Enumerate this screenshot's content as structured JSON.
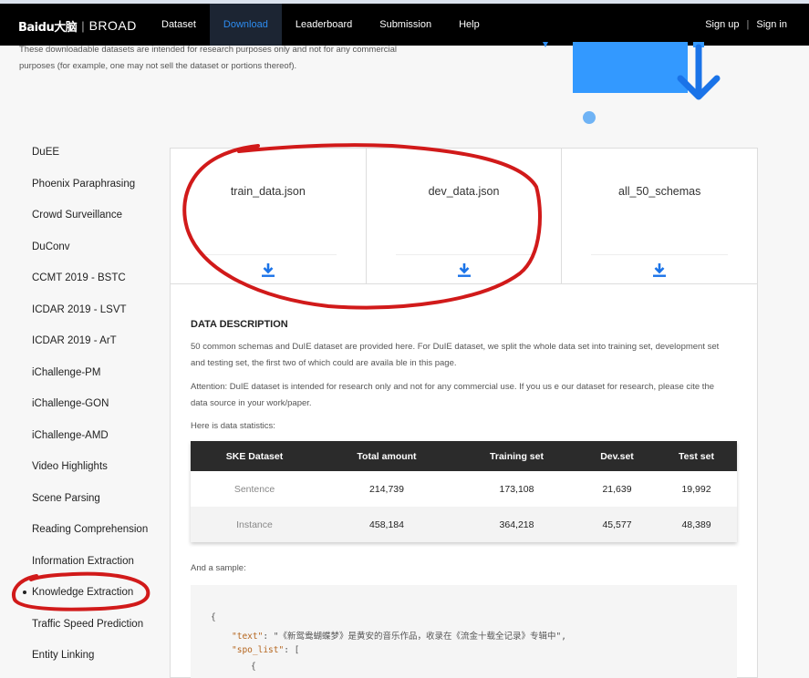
{
  "header": {
    "logo_brand": "Baidu大脑",
    "logo_broad": "BROAD",
    "nav": [
      "Dataset",
      "Download",
      "Leaderboard",
      "Submission",
      "Help"
    ],
    "active_nav": "Download",
    "sign_up": "Sign up",
    "sign_in": "Sign in"
  },
  "intro": {
    "line1": "These downloadable datasets are intended for research purposes only and not for any commercial",
    "line2": "purposes (for example, one may not sell the dataset or portions thereof)."
  },
  "sidebar": {
    "items": [
      "DuEE",
      "Phoenix Paraphrasing",
      "Crowd Surveillance",
      "DuConv",
      "CCMT 2019 - BSTC",
      "ICDAR 2019 - LSVT",
      "ICDAR 2019 - ArT",
      "iChallenge-PM",
      "iChallenge-GON",
      "iChallenge-AMD",
      "Video Highlights",
      "Scene Parsing",
      "Reading Comprehension",
      "Information Extraction",
      "Knowledge Extraction",
      "Traffic Speed Prediction",
      "Entity Linking"
    ],
    "active": "Knowledge Extraction"
  },
  "downloads": [
    {
      "name": "train_data.json",
      "icon": "download-icon"
    },
    {
      "name": "dev_data.json",
      "icon": "download-icon"
    },
    {
      "name": "all_50_schemas",
      "icon": "download-icon"
    }
  ],
  "description": {
    "title": "DATA DESCRIPTION",
    "p1_line1": "50 common schemas and DuIE dataset are provided here. For DuIE dataset, we split the whole data set into training set, development set",
    "p1_line2": "and testing set, the first two of which could are availa ble in this page.",
    "p2_line1": "Attention: DuIE dataset is intended for research only and not for any commercial use. If you us e our dataset for research, please cite the",
    "p2_line2": "data source in your work/paper.",
    "p3": "Here is data statistics:"
  },
  "stats_table": {
    "headers": [
      "SKE Dataset",
      "Total amount",
      "Training set",
      "Dev.set",
      "Test set"
    ],
    "rows": [
      [
        "Sentence",
        "214,739",
        "173,108",
        "21,639",
        "19,992"
      ],
      [
        "Instance",
        "458,184",
        "364,218",
        "45,577",
        "48,389"
      ]
    ]
  },
  "sample": {
    "label": "And a sample:",
    "line1": "{",
    "line2_key": "\"text\"",
    "line2_val": ": \"《新鸳鸯蝴蝶梦》是黄安的音乐作品，收录在《流金十载全记录》专辑中\",",
    "line3_key": "\"spo_list\"",
    "line3_val": ": [",
    "line4": "{"
  },
  "colors": {
    "accent": "#2d8cf0",
    "download_icon": "#1a73e8",
    "annotation": "#d11a1a",
    "header_bg": "#000000"
  }
}
